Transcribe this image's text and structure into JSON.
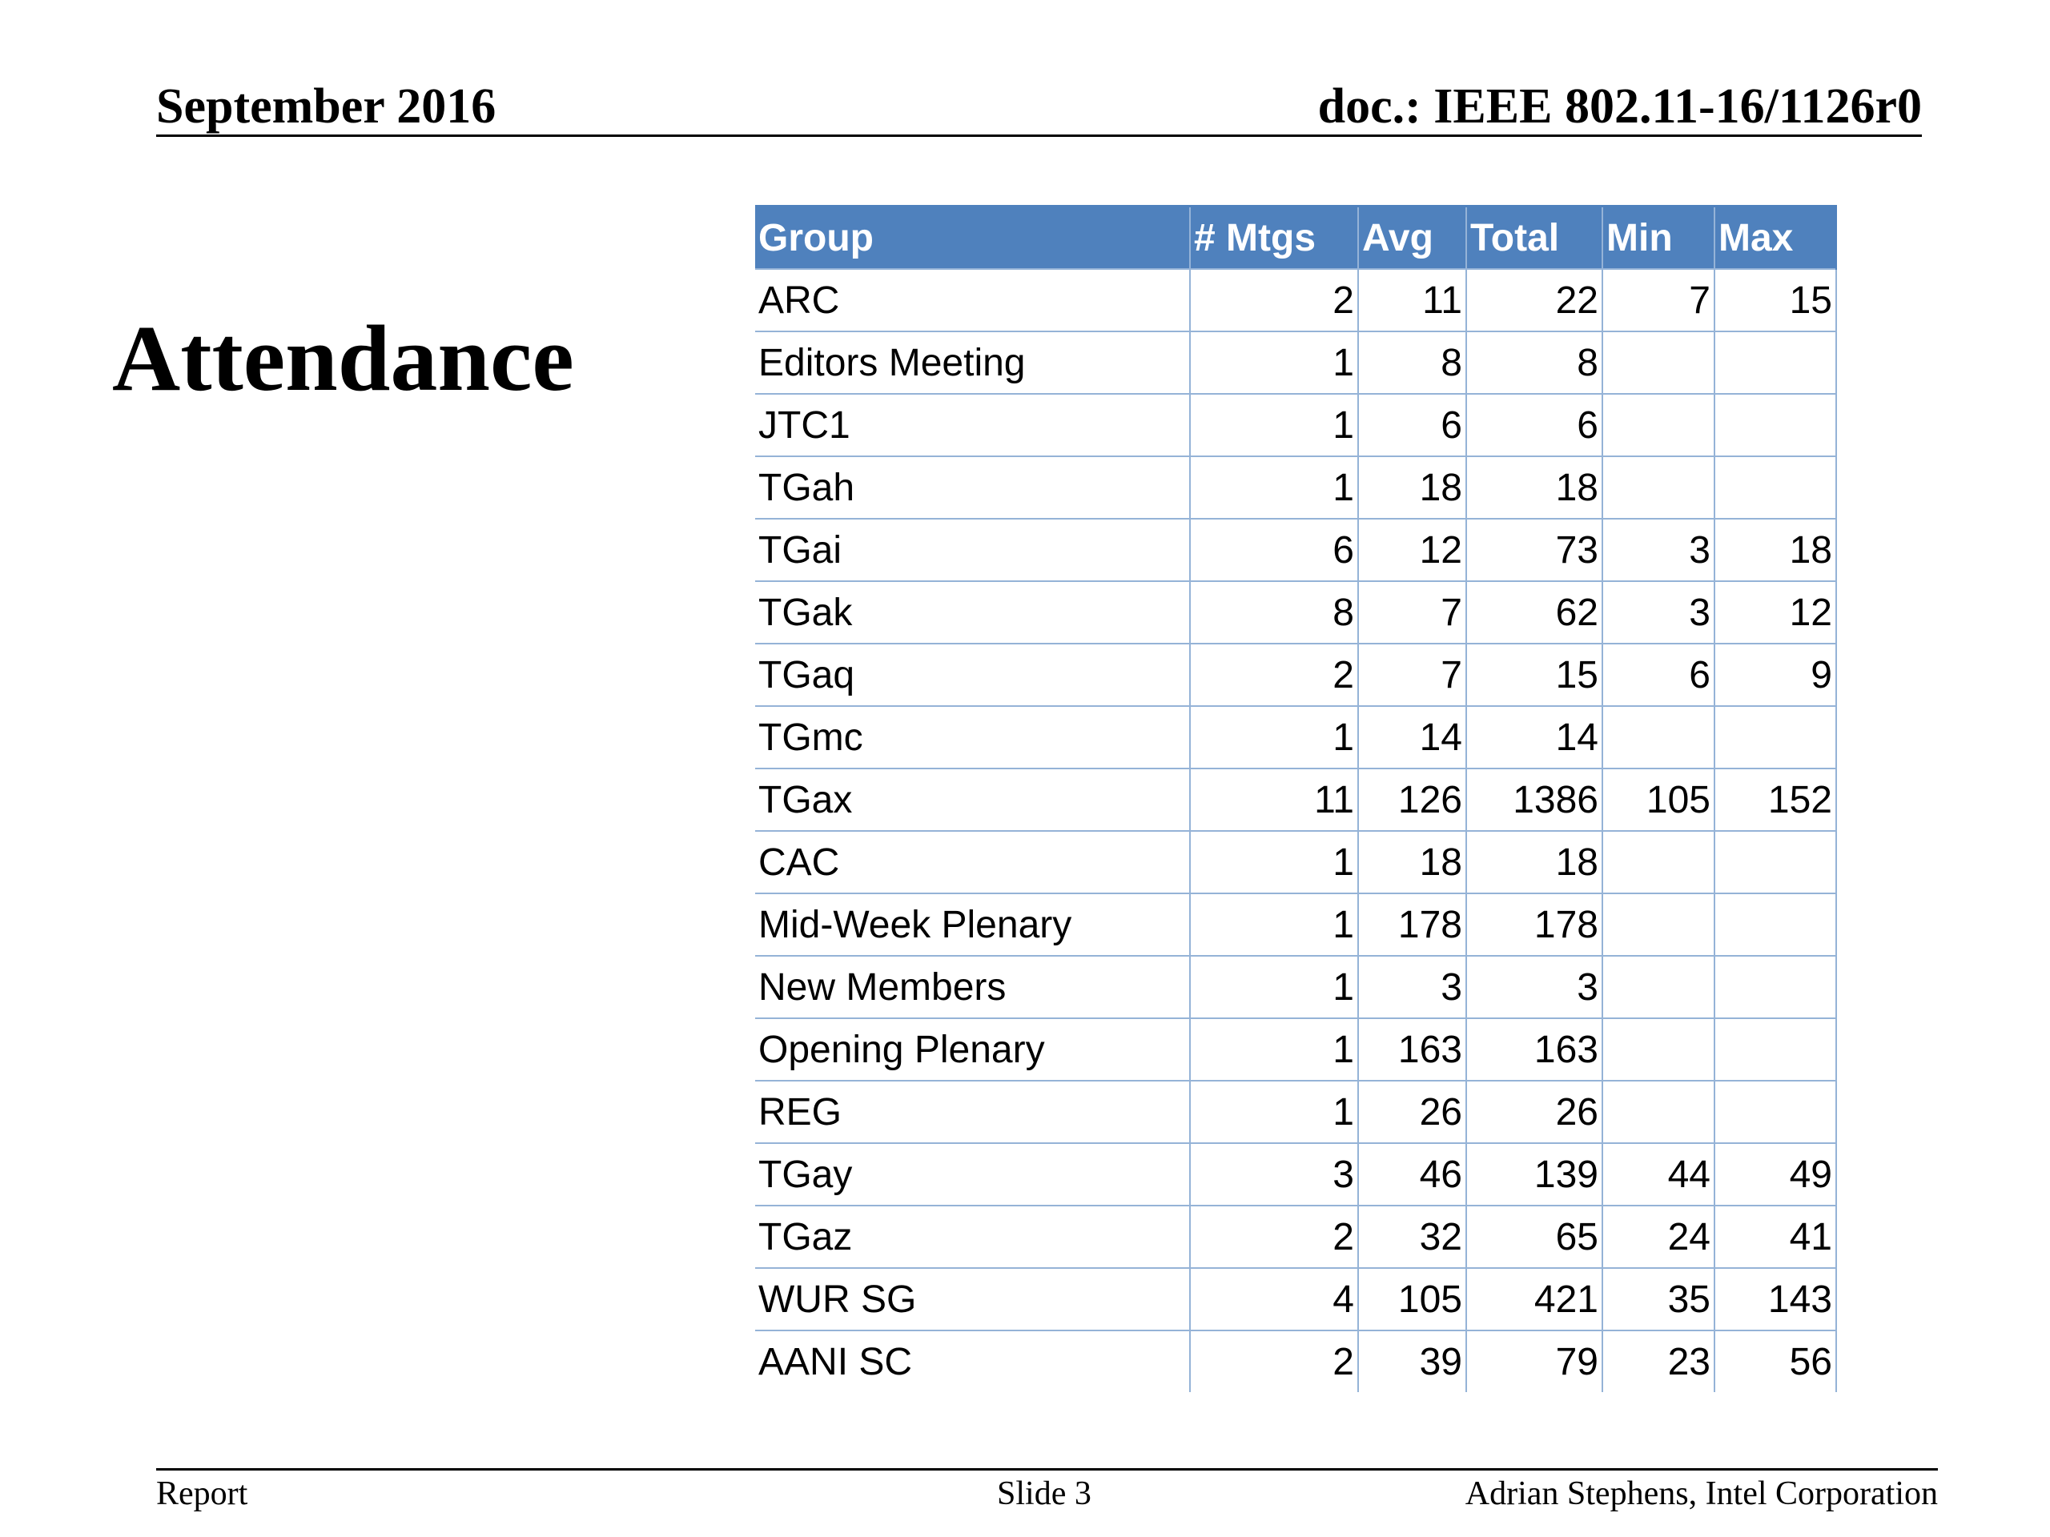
{
  "header": {
    "date": "September 2016",
    "doc": "doc.: IEEE 802.11-16/1126r0"
  },
  "title": "Attendance",
  "table": {
    "header_color": "#4f81bd",
    "columns": [
      "Group",
      "# Mtgs",
      "Avg",
      "Total",
      "Min",
      "Max"
    ],
    "rows": [
      [
        "ARC",
        "2",
        "11",
        "22",
        "7",
        "15"
      ],
      [
        "Editors Meeting",
        "1",
        "8",
        "8",
        "",
        ""
      ],
      [
        "JTC1",
        "1",
        "6",
        "6",
        "",
        ""
      ],
      [
        "TGah",
        "1",
        "18",
        "18",
        "",
        ""
      ],
      [
        "TGai",
        "6",
        "12",
        "73",
        "3",
        "18"
      ],
      [
        "TGak",
        "8",
        "7",
        "62",
        "3",
        "12"
      ],
      [
        "TGaq",
        "2",
        "7",
        "15",
        "6",
        "9"
      ],
      [
        "TGmc",
        "1",
        "14",
        "14",
        "",
        ""
      ],
      [
        "TGax",
        "11",
        "126",
        "1386",
        "105",
        "152"
      ],
      [
        "CAC",
        "1",
        "18",
        "18",
        "",
        ""
      ],
      [
        "Mid-Week Plenary",
        "1",
        "178",
        "178",
        "",
        ""
      ],
      [
        "New Members",
        "1",
        "3",
        "3",
        "",
        ""
      ],
      [
        "Opening Plenary",
        "1",
        "163",
        "163",
        "",
        ""
      ],
      [
        "REG",
        "1",
        "26",
        "26",
        "",
        ""
      ],
      [
        "TGay",
        "3",
        "46",
        "139",
        "44",
        "49"
      ],
      [
        "TGaz",
        "2",
        "32",
        "65",
        "24",
        "41"
      ],
      [
        "WUR SG",
        "4",
        "105",
        "421",
        "35",
        "143"
      ],
      [
        "AANI SC",
        "2",
        "39",
        "79",
        "23",
        "56"
      ]
    ]
  },
  "footer": {
    "left": "Report",
    "center": "Slide 3",
    "right": "Adrian Stephens, Intel Corporation"
  }
}
